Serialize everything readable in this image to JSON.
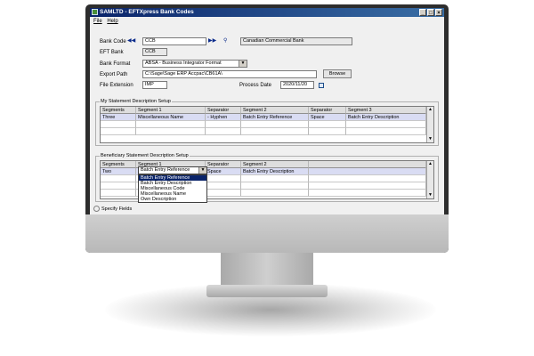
{
  "window": {
    "title": "SAMLTD - EFTXpress Bank Codes",
    "buttons": [
      "_",
      "□",
      "×"
    ]
  },
  "menu": [
    {
      "label": "File"
    },
    {
      "label": "Help"
    }
  ],
  "form": {
    "bank_code": {
      "label": "Bank Code",
      "value": "CCB",
      "description": "Canadian Commercial Bank"
    },
    "eft_bank": {
      "label": "EFT Bank",
      "value": "CCB"
    },
    "bank_format": {
      "label": "Bank Format",
      "value": "ABSA - Business Integrator Format"
    },
    "export_path": {
      "label": "Export Path",
      "value": "C:\\Sage\\Sage ERP Accpac\\CB61A\\",
      "browse_label": "Browse"
    },
    "file_extension": {
      "label": "File Extension",
      "value": "IMP"
    },
    "process_date": {
      "label": "Process Date",
      "value": "2020/11/20"
    }
  },
  "statement_setup": {
    "title": "My Statement Description Setup",
    "columns": [
      "Segments",
      "Segment 1",
      "Separator",
      "Segment 2",
      "Separator",
      "Segment 3"
    ],
    "rows": [
      [
        "Three",
        "Miscellaneous Name",
        "- Hyphen",
        "Batch Entry Reference",
        "Space",
        "Batch Entry Description"
      ]
    ]
  },
  "beneficiary_setup": {
    "title": "Beneficiary Statement Description Setup",
    "columns": [
      "Segments",
      "Segment 1",
      "Separator",
      "Segment 2"
    ],
    "rows": [
      [
        "Two",
        "Batch Entry Reference",
        "Space",
        "Batch Entry Description"
      ]
    ],
    "dropdown_options": [
      "Batch Entry Reference",
      "Batch Entry Description",
      "Miscellaneous Code",
      "Miscellaneous Name",
      "Own Description"
    ],
    "dropdown_selected": "Batch Entry Reference"
  },
  "specify_fields": {
    "label": "Specify Fields"
  },
  "colors": {
    "titlebar": "#0a246a",
    "selected_row": "#d9dcf3",
    "dropdown_highlight": "#0a246a",
    "bezel": "#2d2d2d"
  },
  "icons": [
    "first-record-icon",
    "previous-record-icon",
    "next-record-icon",
    "last-record-icon",
    "search-icon",
    "calendar-icon",
    "dropdown-arrow-icon",
    "app-icon"
  ]
}
